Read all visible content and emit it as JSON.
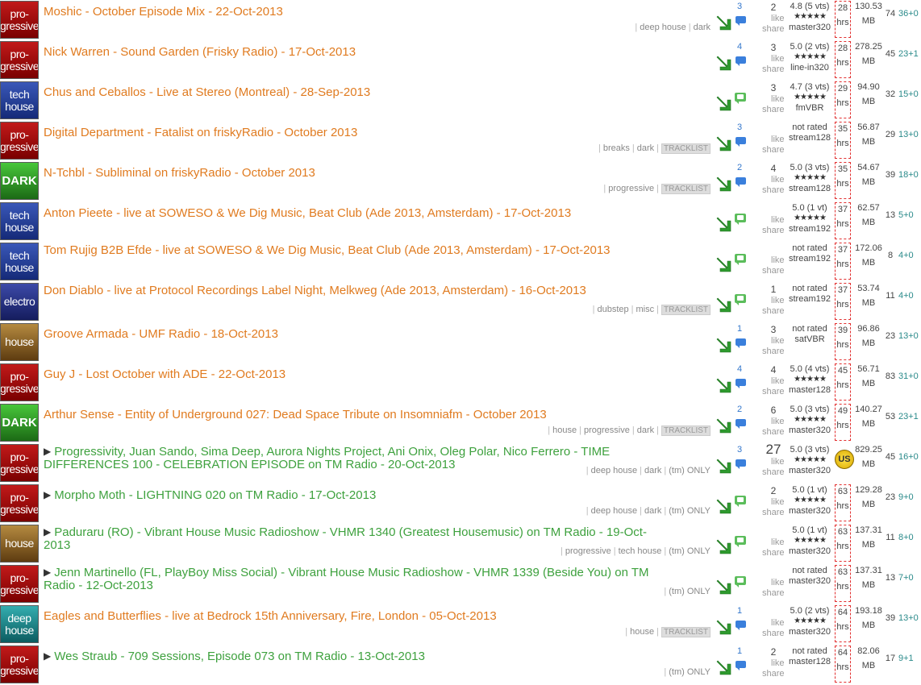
{
  "labels": {
    "like": "like",
    "share": "share",
    "hrs": "hrs",
    "mb": "MB"
  },
  "rows": [
    {
      "genre": "pro-\ngressive",
      "gclass": "progressive",
      "artist": "Moshic",
      "title": " - October Episode Mix - 22-Oct-2013",
      "green": false,
      "triangle": false,
      "tags": [
        "deep house",
        "dark"
      ],
      "tracklist": false,
      "tm": false,
      "arrow": true,
      "comments": "3",
      "bubble": "blue",
      "likes": "2",
      "rating": "4.8 (5 vts)",
      "stars": "★★★★★",
      "quality": "master320",
      "hrs": "28",
      "hot": false,
      "size": "130.53",
      "count": "74",
      "delta": "36+0"
    },
    {
      "genre": "pro-\ngressive",
      "gclass": "progressive",
      "artist": "Nick Warren",
      "title": " - Sound Garden (Frisky Radio) - 17-Oct-2013",
      "green": false,
      "triangle": false,
      "tags": [],
      "tracklist": false,
      "tm": false,
      "arrow": true,
      "comments": "4",
      "bubble": "blue",
      "likes": "3",
      "rating": "5.0 (2 vts)",
      "stars": "★★★★★",
      "quality": "line-in320",
      "hrs": "28",
      "hot": false,
      "size": "278.25",
      "count": "45",
      "delta": "23+1"
    },
    {
      "genre": "tech\nhouse",
      "gclass": "tech",
      "artist": "Chus and Ceballos",
      "title": " - Live at Stereo (Montreal) - 28-Sep-2013",
      "green": false,
      "triangle": false,
      "tags": [],
      "tracklist": false,
      "tm": false,
      "arrow": true,
      "comments": "",
      "bubble": "green",
      "likes": "3",
      "rating": "4.7 (3 vts)",
      "stars": "★★★★★",
      "quality": "fmVBR",
      "hrs": "29",
      "hot": false,
      "size": "94.90",
      "count": "32",
      "delta": "15+0"
    },
    {
      "genre": "pro-\ngressive",
      "gclass": "progressive",
      "artist": "Digital Department",
      "title": " - Fatalist on friskyRadio - October 2013",
      "green": false,
      "triangle": false,
      "tags": [
        "breaks",
        "dark"
      ],
      "tracklist": true,
      "tm": false,
      "arrow": true,
      "comments": "3",
      "bubble": "blue",
      "likes": "",
      "rating": "not rated",
      "stars": "",
      "quality": "stream128",
      "hrs": "35",
      "hot": false,
      "size": "56.87",
      "count": "29",
      "delta": "13+0"
    },
    {
      "genre": "DARK",
      "gclass": "dark",
      "artist": "N-Tchbl",
      "title": " - Subliminal on friskyRadio - October 2013",
      "green": false,
      "triangle": false,
      "tags": [
        "progressive"
      ],
      "tracklist": true,
      "tm": false,
      "arrow": true,
      "comments": "2",
      "bubble": "blue",
      "likes": "4",
      "rating": "5.0 (3 vts)",
      "stars": "★★★★★",
      "quality": "stream128",
      "hrs": "35",
      "hot": false,
      "size": "54.67",
      "count": "39",
      "delta": "18+0"
    },
    {
      "genre": "tech\nhouse",
      "gclass": "tech",
      "artist": "Anton Pieete",
      "title": " - live at SOWESO & We Dig Music, Beat Club (Ade 2013, Amsterdam) - 17-Oct-2013",
      "green": false,
      "triangle": false,
      "tags": [],
      "tracklist": false,
      "tm": false,
      "arrow": true,
      "comments": "",
      "bubble": "green",
      "likes": "",
      "rating": "5.0 (1 vt)",
      "stars": "★★★★★",
      "quality": "stream192",
      "hrs": "37",
      "hot": false,
      "size": "62.57",
      "count": "13",
      "delta": "5+0"
    },
    {
      "genre": "tech\nhouse",
      "gclass": "tech",
      "artist": "Tom Rujig B2B Efde",
      "title": " - live at SOWESO & We Dig Music, Beat Club (Ade 2013, Amsterdam) - 17-Oct-2013",
      "green": false,
      "triangle": false,
      "tags": [],
      "tracklist": false,
      "tm": false,
      "arrow": true,
      "comments": "",
      "bubble": "green",
      "likes": "",
      "rating": "not rated",
      "stars": "",
      "quality": "stream192",
      "hrs": "37",
      "hot": false,
      "size": "172.06",
      "count": "8",
      "delta": "4+0"
    },
    {
      "genre": "electro",
      "gclass": "electro",
      "artist": "Don Diablo",
      "title": " - live at Protocol Recordings Label Night, Melkweg (Ade 2013, Amsterdam) - 16-Oct-2013",
      "green": false,
      "triangle": false,
      "tags": [
        "dubstep",
        "misc"
      ],
      "tracklist": true,
      "tm": false,
      "arrow": true,
      "comments": "",
      "bubble": "green",
      "likes": "1",
      "rating": "not rated",
      "stars": "",
      "quality": "stream192",
      "hrs": "37",
      "hot": false,
      "size": "53.74",
      "count": "11",
      "delta": "4+0"
    },
    {
      "genre": "house",
      "gclass": "house",
      "artist": "Groove Armada",
      "title": " - UMF Radio - 18-Oct-2013",
      "green": false,
      "triangle": false,
      "tags": [],
      "tracklist": false,
      "tm": false,
      "arrow": true,
      "comments": "1",
      "bubble": "blue",
      "likes": "3",
      "rating": "not rated",
      "stars": "",
      "quality": "satVBR",
      "hrs": "39",
      "hot": false,
      "size": "96.86",
      "count": "23",
      "delta": "13+0"
    },
    {
      "genre": "pro-\ngressive",
      "gclass": "progressive",
      "artist": "Guy J",
      "title": " - Lost October with ADE - 22-Oct-2013",
      "green": false,
      "triangle": false,
      "tags": [],
      "tracklist": false,
      "tm": false,
      "arrow": true,
      "comments": "4",
      "bubble": "blue",
      "likes": "4",
      "rating": "5.0 (4 vts)",
      "stars": "★★★★★",
      "quality": "master128",
      "hrs": "45",
      "hot": false,
      "size": "56.71",
      "count": "83",
      "delta": "31+0"
    },
    {
      "genre": "DARK",
      "gclass": "dark",
      "artist": "Arthur Sense",
      "title": " - Entity of Underground 027: Dead Space Tribute on Insomniafm - October 2013",
      "green": false,
      "triangle": false,
      "tags": [
        "house",
        "progressive",
        "dark"
      ],
      "tracklist": true,
      "tm": false,
      "arrow": true,
      "comments": "2",
      "bubble": "blue",
      "likes": "6",
      "rating": "5.0 (3 vts)",
      "stars": "★★★★★",
      "quality": "master320",
      "hrs": "49",
      "hot": false,
      "size": "140.27",
      "count": "53",
      "delta": "23+1"
    },
    {
      "genre": "pro-\ngressive",
      "gclass": "progressive",
      "artist": "Progressivity, Juan Sando, Sima Deep, Aurora Nights Project, Ani Onix, Oleg Polar, Nico Ferrero",
      "title": " - TIME DIFFERENCES 100 - CELEBRATION EPISODE on TM Radio - 20-Oct-2013",
      "green": true,
      "triangle": true,
      "tags": [
        "deep house",
        "dark"
      ],
      "tracklist": false,
      "tm": true,
      "arrow": true,
      "comments": "3",
      "bubble": "blue",
      "likes": "27",
      "rating": "5.0 (3 vts)",
      "stars": "★★★★★",
      "quality": "master320",
      "hrs": "",
      "hot": true,
      "size": "829.25",
      "count": "45",
      "delta": "16+0"
    },
    {
      "genre": "pro-\ngressive",
      "gclass": "progressive",
      "artist": "Morpho Moth",
      "title": " - LIGHTNING 020 on TM Radio - 17-Oct-2013",
      "green": true,
      "triangle": true,
      "tags": [
        "deep house",
        "dark"
      ],
      "tracklist": false,
      "tm": true,
      "arrow": true,
      "comments": "",
      "bubble": "green",
      "likes": "2",
      "rating": "5.0 (1 vt)",
      "stars": "★★★★★",
      "quality": "master320",
      "hrs": "63",
      "hot": false,
      "size": "129.28",
      "count": "23",
      "delta": "9+0"
    },
    {
      "genre": "house",
      "gclass": "house",
      "artist": "Paduraru (RO)",
      "title": " - Vibrant House Music Radioshow - VHMR 1340 (Greatest Housemusic) on TM Radio - 19-Oct-2013",
      "green": true,
      "triangle": true,
      "tags": [
        "progressive",
        "tech house"
      ],
      "tracklist": false,
      "tm": true,
      "arrow": true,
      "comments": "",
      "bubble": "green",
      "likes": "",
      "rating": "5.0 (1 vt)",
      "stars": "★★★★★",
      "quality": "master320",
      "hrs": "63",
      "hot": false,
      "size": "137.31",
      "count": "11",
      "delta": "8+0"
    },
    {
      "genre": "pro-\ngressive",
      "gclass": "progressive",
      "artist": "Jenn Martinello (FL, PlayBoy Miss Social)",
      "title": " - Vibrant House Music Radioshow - VHMR 1339 (Beside You) on TM Radio - 12-Oct-2013",
      "green": true,
      "triangle": true,
      "tags": [],
      "tracklist": false,
      "tm": true,
      "arrow": true,
      "comments": "",
      "bubble": "green",
      "likes": "",
      "rating": "not rated",
      "stars": "",
      "quality": "master320",
      "hrs": "63",
      "hot": false,
      "size": "137.31",
      "count": "13",
      "delta": "7+0"
    },
    {
      "genre": "deep\nhouse",
      "gclass": "deep",
      "artist": "Eagles and Butterflies",
      "title": " - live at Bedrock 15th Anniversary, Fire, London - 05-Oct-2013",
      "green": false,
      "triangle": false,
      "tags": [
        "house"
      ],
      "tracklist": true,
      "tm": false,
      "arrow": true,
      "comments": "1",
      "bubble": "blue",
      "likes": "",
      "rating": "5.0 (2 vts)",
      "stars": "★★★★★",
      "quality": "master320",
      "hrs": "64",
      "hot": false,
      "size": "193.18",
      "count": "39",
      "delta": "13+0"
    },
    {
      "genre": "pro-\ngressive",
      "gclass": "progressive",
      "artist": "Wes Straub",
      "title": " - 709 Sessions, Episode 073 on TM Radio - 13-Oct-2013",
      "green": true,
      "triangle": true,
      "tags": [],
      "tracklist": false,
      "tm": true,
      "arrow": true,
      "comments": "1",
      "bubble": "blue",
      "likes": "2",
      "rating": "not rated",
      "stars": "",
      "quality": "master128",
      "hrs": "64",
      "hot": false,
      "size": "82.06",
      "count": "17",
      "delta": "9+1"
    }
  ],
  "tracklist_label": "TRACKLIST",
  "tm_label": "(tm) ONLY",
  "hot_label": "US",
  "colors": {
    "orange_title": "#e07b20",
    "green_title": "#3ea13e",
    "hrs_border": "#e23030",
    "delta": "#2a8a8a"
  }
}
